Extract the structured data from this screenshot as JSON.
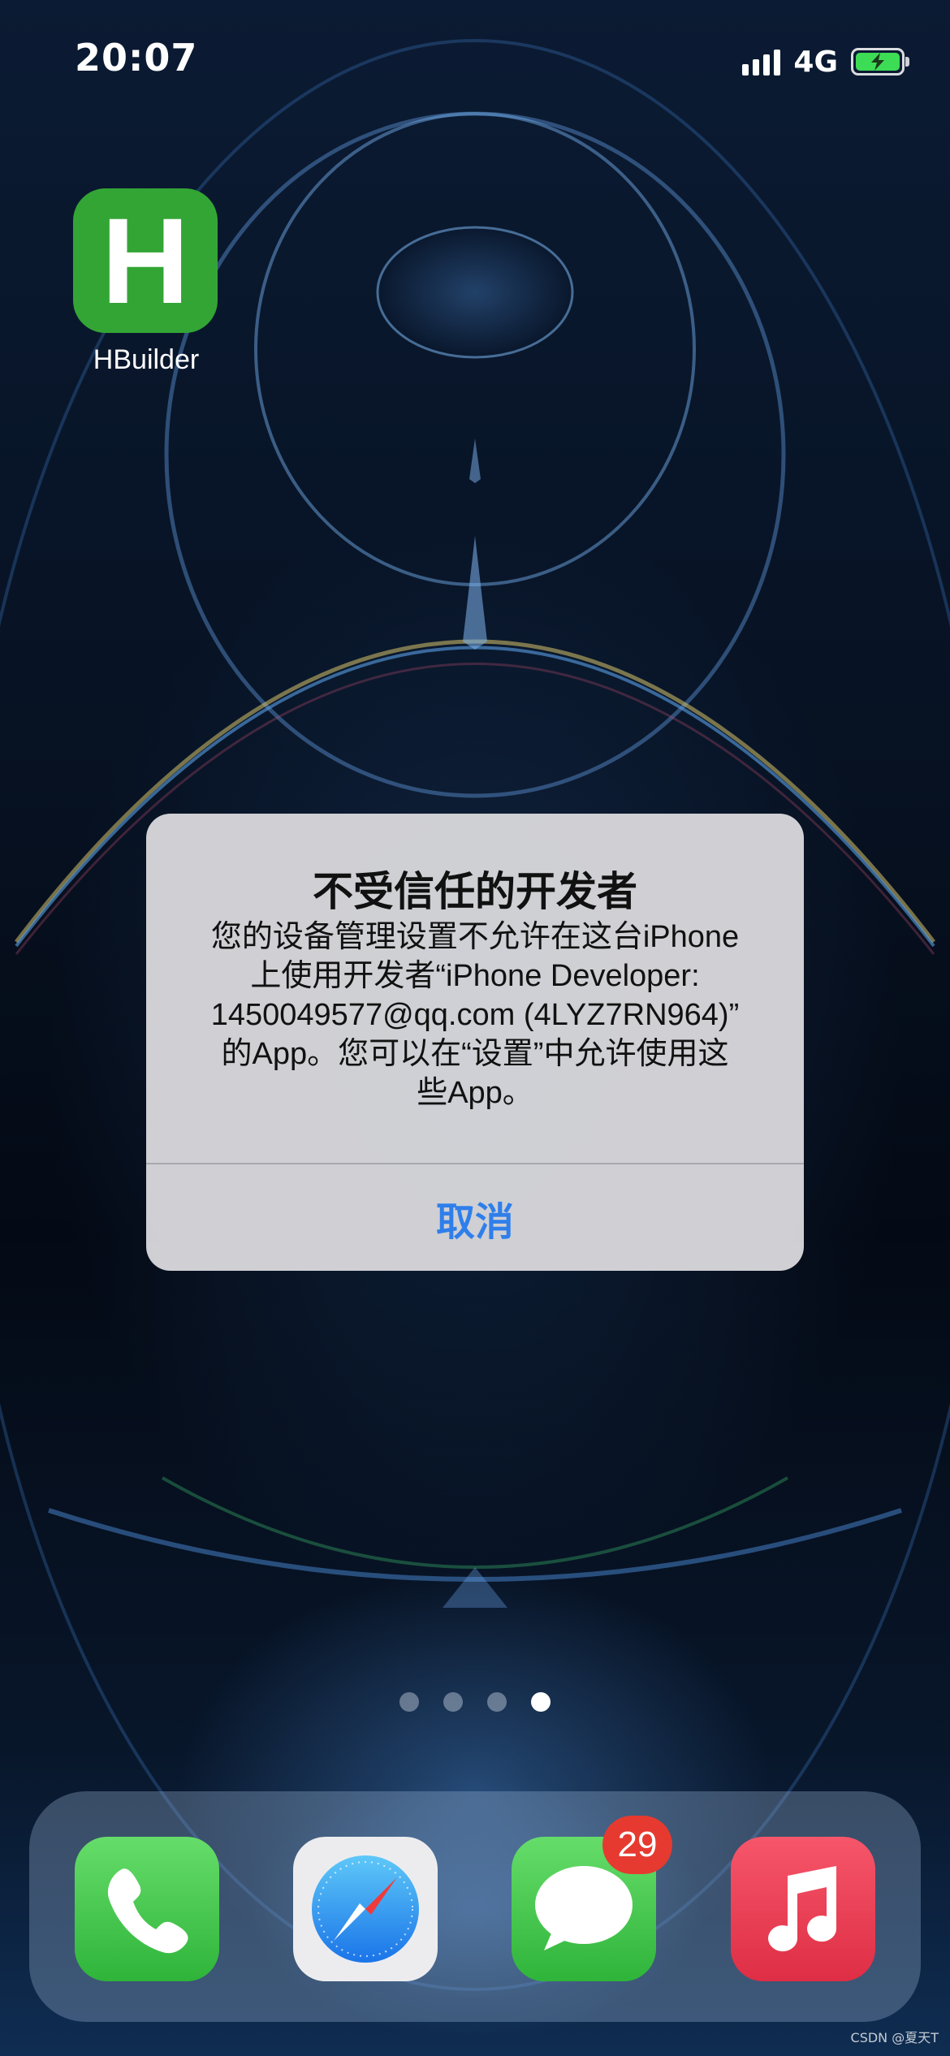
{
  "status_bar": {
    "time": "20:07",
    "network": "4G",
    "icons": [
      "cellular-signal-icon",
      "battery-charging-icon"
    ]
  },
  "home_screen": {
    "apps": [
      {
        "label": "HBuilder",
        "glyph": "H",
        "icon": "hbuilder-app-icon",
        "color": "#33a535"
      }
    ],
    "page_dots": {
      "count": 4,
      "active_index": 3
    }
  },
  "alert": {
    "title": "不受信任的开发者",
    "message_lines": [
      "您的设备管理设置不允许在这台iPhone",
      "上使用开发者“iPhone Developer:",
      "1450049577@qq.com (4LYZ7RN964)”",
      "的App。您可以在“设置”中允许使用这",
      "些App。"
    ],
    "cancel_label": "取消",
    "button_color": "#2f7fea"
  },
  "dock": {
    "apps": [
      {
        "name": "Phone",
        "icon": "phone-icon"
      },
      {
        "name": "Safari",
        "icon": "safari-compass-icon"
      },
      {
        "name": "Messages",
        "icon": "messages-bubble-icon",
        "badge": "29"
      },
      {
        "name": "Music",
        "icon": "music-note-icon"
      }
    ]
  },
  "watermark": "CSDN @夏天T"
}
